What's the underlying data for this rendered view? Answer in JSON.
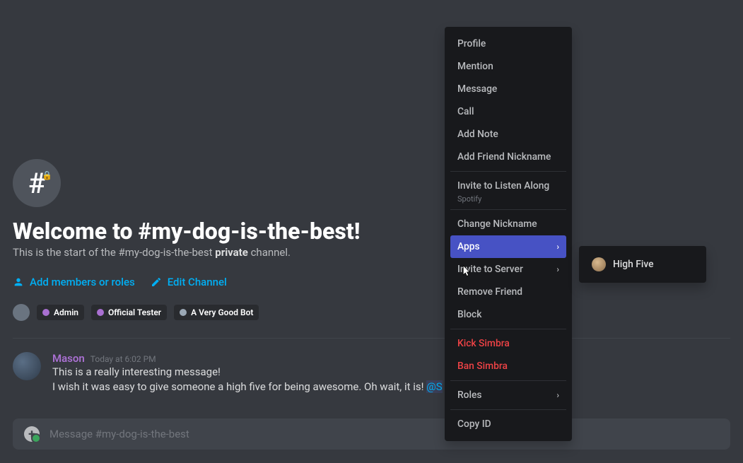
{
  "channel": {
    "name": "#my-dog-is-the-best",
    "welcome_title": "Welcome to #my-dog-is-the-best!",
    "subtitle_prefix": "This is the start of the #my-dog-is-the-best ",
    "subtitle_bold": "private",
    "subtitle_suffix": " channel."
  },
  "actions": {
    "add_members": "Add members or roles",
    "edit_channel": "Edit Channel"
  },
  "roles": [
    {
      "label": "Admin",
      "color": "#a970d1"
    },
    {
      "label": "Official Tester",
      "color": "#a970d1"
    },
    {
      "label": "A Very Good Bot",
      "color": "#9ba8b5"
    }
  ],
  "message": {
    "author": "Mason",
    "timestamp": "Today at 6:02 PM",
    "line1": "This is a really interesting message!",
    "line2_prefix": "I wish it was easy to give someone a high five for being awesome. Oh wait, it is! ",
    "line2_mention": "@S"
  },
  "input": {
    "placeholder": "Message #my-dog-is-the-best"
  },
  "context_menu": {
    "items": [
      {
        "label": "Profile",
        "type": "normal"
      },
      {
        "label": "Mention",
        "type": "normal"
      },
      {
        "label": "Message",
        "type": "normal"
      },
      {
        "label": "Call",
        "type": "normal"
      },
      {
        "label": "Add Note",
        "type": "normal"
      },
      {
        "label": "Add Friend Nickname",
        "type": "normal"
      },
      {
        "type": "separator"
      },
      {
        "label": "Invite to Listen Along",
        "sublabel": "Spotify",
        "type": "withsub"
      },
      {
        "type": "separator"
      },
      {
        "label": "Change Nickname",
        "type": "normal"
      },
      {
        "label": "Apps",
        "type": "submenu",
        "hovered": true
      },
      {
        "label": "Invite to Server",
        "type": "submenu"
      },
      {
        "label": "Remove Friend",
        "type": "normal"
      },
      {
        "label": "Block",
        "type": "normal"
      },
      {
        "type": "separator"
      },
      {
        "label": "Kick Simbra",
        "type": "danger"
      },
      {
        "label": "Ban Simbra",
        "type": "danger"
      },
      {
        "type": "separator"
      },
      {
        "label": "Roles",
        "type": "submenu"
      },
      {
        "type": "separator"
      },
      {
        "label": "Copy ID",
        "type": "normal"
      }
    ]
  },
  "submenu": {
    "item": "High Five"
  }
}
